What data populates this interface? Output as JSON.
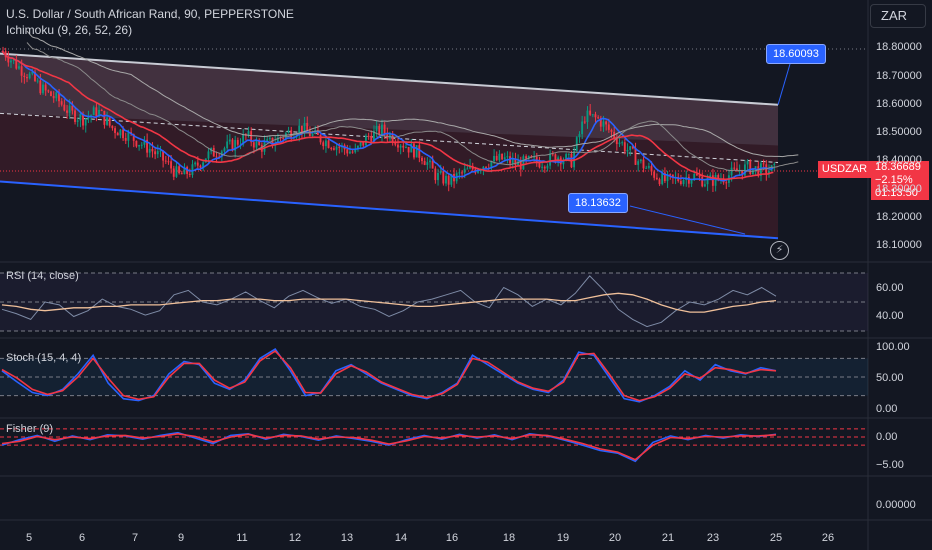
{
  "header": {
    "title": "U.S. Dollar / South African Rand, 90, PEPPERSTONE",
    "ichimoku_label": "Ichimoku (9, 26, 52, 26)",
    "currency": "ZAR"
  },
  "callouts": {
    "upper": "18.60093",
    "lower": "18.13632"
  },
  "price_tag": {
    "symbol": "USDZAR",
    "price": "18.36689",
    "change": "−2.15%",
    "countdown": "01:13:50"
  },
  "colors": {
    "background": "#131722",
    "up": "#089981",
    "down": "#f23645",
    "rsi": "#7e8ba6",
    "rsi_ma": "#f0c09a",
    "stoch_k": "#2962ff",
    "stoch_d": "#f23645",
    "channel_upper": "#c8cbd4",
    "channel_lower": "#2962ff"
  },
  "icons": {
    "alert": "lightning-icon"
  },
  "chart_data": [
    {
      "type": "candlestick",
      "title": "U.S. Dollar / South African Rand, 90, PEPPERSTONE",
      "ylim": [
        18.05,
        18.85
      ],
      "yticks": [
        "18.80000",
        "18.70000",
        "18.60000",
        "18.50000",
        "18.40000",
        "18.30000",
        "18.20000",
        "18.10000"
      ],
      "xticks": [
        "5",
        "6",
        "7",
        "9",
        "11",
        "12",
        "13",
        "14",
        "16",
        "18",
        "19",
        "20",
        "21",
        "23",
        "25",
        "26"
      ],
      "price_path": [
        18.79,
        18.74,
        18.7,
        18.65,
        18.62,
        18.57,
        18.55,
        18.58,
        18.52,
        18.5,
        18.47,
        18.44,
        18.4,
        18.35,
        18.37,
        18.42,
        18.44,
        18.46,
        18.49,
        18.45,
        18.47,
        18.5,
        18.52,
        18.49,
        18.47,
        18.45,
        18.43,
        18.49,
        18.51,
        18.48,
        18.45,
        18.42,
        18.35,
        18.33,
        18.36,
        18.38,
        18.4,
        18.41,
        18.39,
        18.4,
        18.4,
        18.42,
        18.4,
        18.56,
        18.55,
        18.5,
        18.45,
        18.4,
        18.36,
        18.33,
        18.34,
        18.35,
        18.33,
        18.34,
        18.36,
        18.38,
        18.37,
        18.37
      ],
      "channel": {
        "upper": [
          18.78,
          18.6
        ],
        "lower": [
          18.33,
          18.13
        ],
        "mid_start": 18.57
      },
      "annotations": [
        "18.60093",
        "18.13632"
      ],
      "last_price": 18.36689
    },
    {
      "type": "line",
      "title": "RSI (14, close)",
      "ylim": [
        30,
        70
      ],
      "yticks": [
        "60.00",
        "40.00"
      ],
      "bands": [
        70,
        50,
        30
      ],
      "series": [
        {
          "name": "RSI",
          "values": [
            45,
            42,
            38,
            50,
            48,
            40,
            44,
            52,
            47,
            45,
            41,
            44,
            55,
            58,
            50,
            48,
            52,
            57,
            51,
            46,
            54,
            58,
            53,
            49,
            52,
            47,
            45,
            40,
            44,
            50,
            52,
            55,
            58,
            50,
            46,
            60,
            55,
            47,
            52,
            48,
            56,
            68,
            58,
            45,
            38,
            33,
            36,
            44,
            50,
            48,
            52,
            58,
            55,
            60,
            54
          ]
        },
        {
          "name": "MA",
          "values": [
            48,
            47,
            45,
            44,
            45,
            46,
            46,
            47,
            47,
            48,
            48,
            48,
            49,
            50,
            51,
            51,
            52,
            52,
            52,
            51,
            51,
            52,
            52,
            52,
            52,
            51,
            50,
            49,
            48,
            47,
            47,
            48,
            49,
            50,
            51,
            52,
            52,
            52,
            52,
            51,
            51,
            53,
            55,
            56,
            55,
            52,
            48,
            45,
            43,
            43,
            45,
            47,
            48,
            50,
            51
          ]
        }
      ]
    },
    {
      "type": "line",
      "title": "Stoch (15, 4, 4)",
      "ylim": [
        0,
        100
      ],
      "yticks": [
        "100.00",
        "50.00",
        "0.00"
      ],
      "bands": [
        80,
        50,
        20
      ],
      "series": [
        {
          "name": "%K",
          "values": [
            60,
            42,
            25,
            20,
            30,
            55,
            85,
            40,
            15,
            12,
            20,
            55,
            75,
            70,
            40,
            30,
            45,
            80,
            95,
            60,
            20,
            25,
            60,
            70,
            55,
            40,
            30,
            20,
            15,
            25,
            40,
            85,
            70,
            55,
            40,
            30,
            25,
            45,
            90,
            85,
            50,
            15,
            10,
            20,
            35,
            60,
            45,
            70,
            60,
            55,
            65,
            60
          ]
        },
        {
          "name": "%D",
          "values": [
            62,
            48,
            30,
            22,
            28,
            50,
            80,
            48,
            20,
            14,
            18,
            50,
            72,
            72,
            45,
            32,
            42,
            76,
            92,
            65,
            25,
            24,
            55,
            68,
            58,
            42,
            32,
            22,
            17,
            23,
            38,
            80,
            74,
            58,
            42,
            32,
            27,
            42,
            86,
            88,
            55,
            20,
            12,
            18,
            32,
            55,
            48,
            65,
            62,
            56,
            62,
            60
          ]
        }
      ]
    },
    {
      "type": "line",
      "title": "Fisher (9)",
      "yticks": [
        "0.00",
        "−5.00"
      ],
      "series": [
        {
          "name": "Fisher",
          "values": [
            -1.5,
            -0.5,
            0.3,
            -0.8,
            0.2,
            -0.5,
            0.4,
            0.2,
            -0.4,
            0.3,
            0.8,
            -0.2,
            -1.2,
            0.3,
            0.6,
            -0.4,
            0.5,
            0.1,
            -0.6,
            0.2,
            -0.3,
            -0.8,
            -1.5,
            -0.5,
            0.3,
            -0.4,
            0.5,
            -0.2,
            0.4,
            -0.5,
            0.6,
            0.2,
            -0.6,
            -1.5,
            -2.5,
            -3.0,
            -4.5,
            -1.0,
            0.2,
            -0.5,
            0.3,
            -0.2,
            0.4,
            0.1,
            0.5
          ]
        },
        {
          "name": "Trigger",
          "values": [
            -1.2,
            -0.8,
            0.1,
            -0.5,
            0.0,
            -0.3,
            0.2,
            0.3,
            -0.2,
            0.1,
            0.6,
            0.1,
            -0.9,
            0.0,
            0.5,
            -0.2,
            0.3,
            0.2,
            -0.4,
            0.0,
            -0.1,
            -0.6,
            -1.3,
            -0.7,
            0.1,
            -0.2,
            0.3,
            0.0,
            0.2,
            -0.3,
            0.4,
            0.3,
            -0.4,
            -1.2,
            -2.2,
            -2.8,
            -4.2,
            -1.5,
            -0.1,
            -0.3,
            0.1,
            0.0,
            0.2,
            0.2,
            0.4
          ]
        }
      ]
    },
    {
      "type": "line",
      "title": "",
      "yticks": [
        "0.00000"
      ]
    }
  ]
}
